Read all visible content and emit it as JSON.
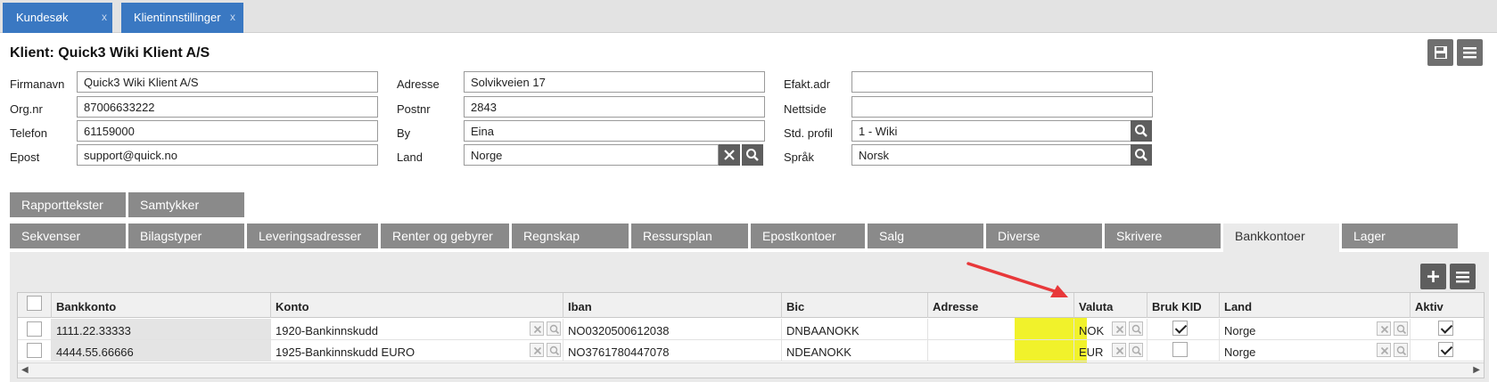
{
  "window_tabs": [
    {
      "label": "Kundesøk",
      "close": "x"
    },
    {
      "label": "Klientinnstillinger",
      "close": "x"
    }
  ],
  "page": {
    "title": "Klient: Quick3 Wiki Klient A/S"
  },
  "toolbar": {
    "save_icon": "save-icon",
    "menu_icon": "menu-icon"
  },
  "form": {
    "firmanavn": {
      "label": "Firmanavn",
      "value": "Quick3 Wiki Klient A/S"
    },
    "orgnr": {
      "label": "Org.nr",
      "value": "87006633222"
    },
    "telefon": {
      "label": "Telefon",
      "value": "61159000"
    },
    "epost": {
      "label": "Epost",
      "value": "support@quick.no"
    },
    "adresse": {
      "label": "Adresse",
      "value": "Solvikveien 17"
    },
    "postnr": {
      "label": "Postnr",
      "value": "2843"
    },
    "by": {
      "label": "By",
      "value": "Eina"
    },
    "land": {
      "label": "Land",
      "value": "Norge"
    },
    "efakt": {
      "label": "Efakt.adr",
      "value": ""
    },
    "nettside": {
      "label": "Nettside",
      "value": ""
    },
    "profil": {
      "label": "Std. profil",
      "value": "1 - Wiki"
    },
    "sprak": {
      "label": "Språk",
      "value": "Norsk"
    }
  },
  "tabs_row1": [
    "Rapporttekster",
    "Samtykker"
  ],
  "tabs_row2": [
    "Sekvenser",
    "Bilagstyper",
    "Leveringsadresser",
    "Renter og gebyrer",
    "Regnskap",
    "Ressursplan",
    "Epostkontoer",
    "Salg",
    "Diverse",
    "Skrivere",
    "Bankkontoer",
    "Lager"
  ],
  "active_tab": "Bankkontoer",
  "table": {
    "columns": [
      "Bankkonto",
      "Konto",
      "Iban",
      "Bic",
      "Adresse",
      "Valuta",
      "Bruk KID",
      "Land",
      "Aktiv"
    ],
    "rows": [
      {
        "bankkonto": "1111.22.33333",
        "konto": "1920-Bankinnskudd",
        "iban": "NO0320500612038",
        "bic": "DNBAANOKK",
        "adresse": "",
        "valuta": "NOK",
        "bruk_kid": true,
        "land": "Norge",
        "aktiv": true
      },
      {
        "bankkonto": "4444.55.66666",
        "konto": "1925-Bankinnskudd EURO",
        "iban": "NO3761780447078",
        "bic": "NDEANOKK",
        "adresse": "",
        "valuta": "EUR",
        "bruk_kid": false,
        "land": "Norge",
        "aktiv": true
      }
    ]
  },
  "colors": {
    "accent_tab": "#3a78c2",
    "highlight": "#f1f22b",
    "arrow": "#e8383a",
    "tab_gray": "#8a8a8a"
  }
}
